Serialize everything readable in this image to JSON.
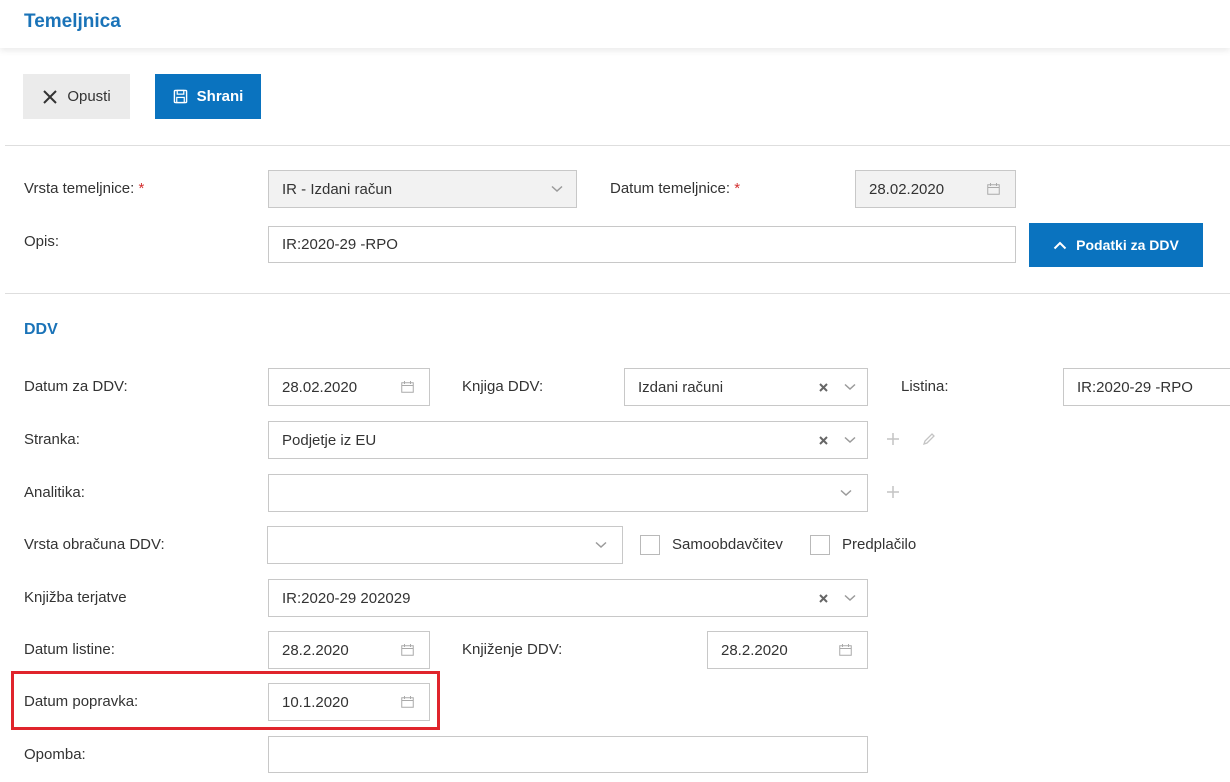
{
  "header": {
    "title": "Temeljnica"
  },
  "toolbar": {
    "cancel_label": "Opusti",
    "save_label": "Shrani"
  },
  "form": {
    "vrsta_label": "Vrsta temeljnice:",
    "vrsta_value": "IR - Izdani račun",
    "datum_label": "Datum temeljnice:",
    "datum_value": "28.02.2020",
    "required_mark": "*",
    "opis_label": "Opis:",
    "opis_value": "IR:2020-29 -RPO",
    "vat_button_label": "Podatki za DDV"
  },
  "ddv": {
    "title": "DDV",
    "datum_ddv_label": "Datum za DDV:",
    "datum_ddv_value": "28.02.2020",
    "knjiga_label": "Knjiga DDV:",
    "knjiga_value": "Izdani računi",
    "listina_label": "Listina:",
    "listina_value": "IR:2020-29 -RPO",
    "stranka_label": "Stranka:",
    "stranka_value": "Podjetje iz EU",
    "analitika_label": "Analitika:",
    "analitika_value": "",
    "vrsta_obr_label": "Vrsta obračuna DDV:",
    "vrsta_obr_value": "",
    "samoobdavcitev_label": "Samoobdavčitev",
    "predplacilo_label": "Predplačilo",
    "knjizba_label": "Knjižba terjatve",
    "knjizba_value": "IR:2020-29 202029",
    "datum_listine_label": "Datum listine:",
    "datum_listine_value": "28.2.2020",
    "knjizenje_label": "Knjiženje DDV:",
    "knjizenje_value": "28.2.2020",
    "datum_popravka_label": "Datum popravka:",
    "datum_popravka_value": "10.1.2020",
    "opomba_label": "Opomba:",
    "opomba_value": ""
  },
  "colors": {
    "accent": "#0a73bf",
    "title": "#1a73b8",
    "highlight": "#e0242c",
    "required": "#d32f2f"
  }
}
